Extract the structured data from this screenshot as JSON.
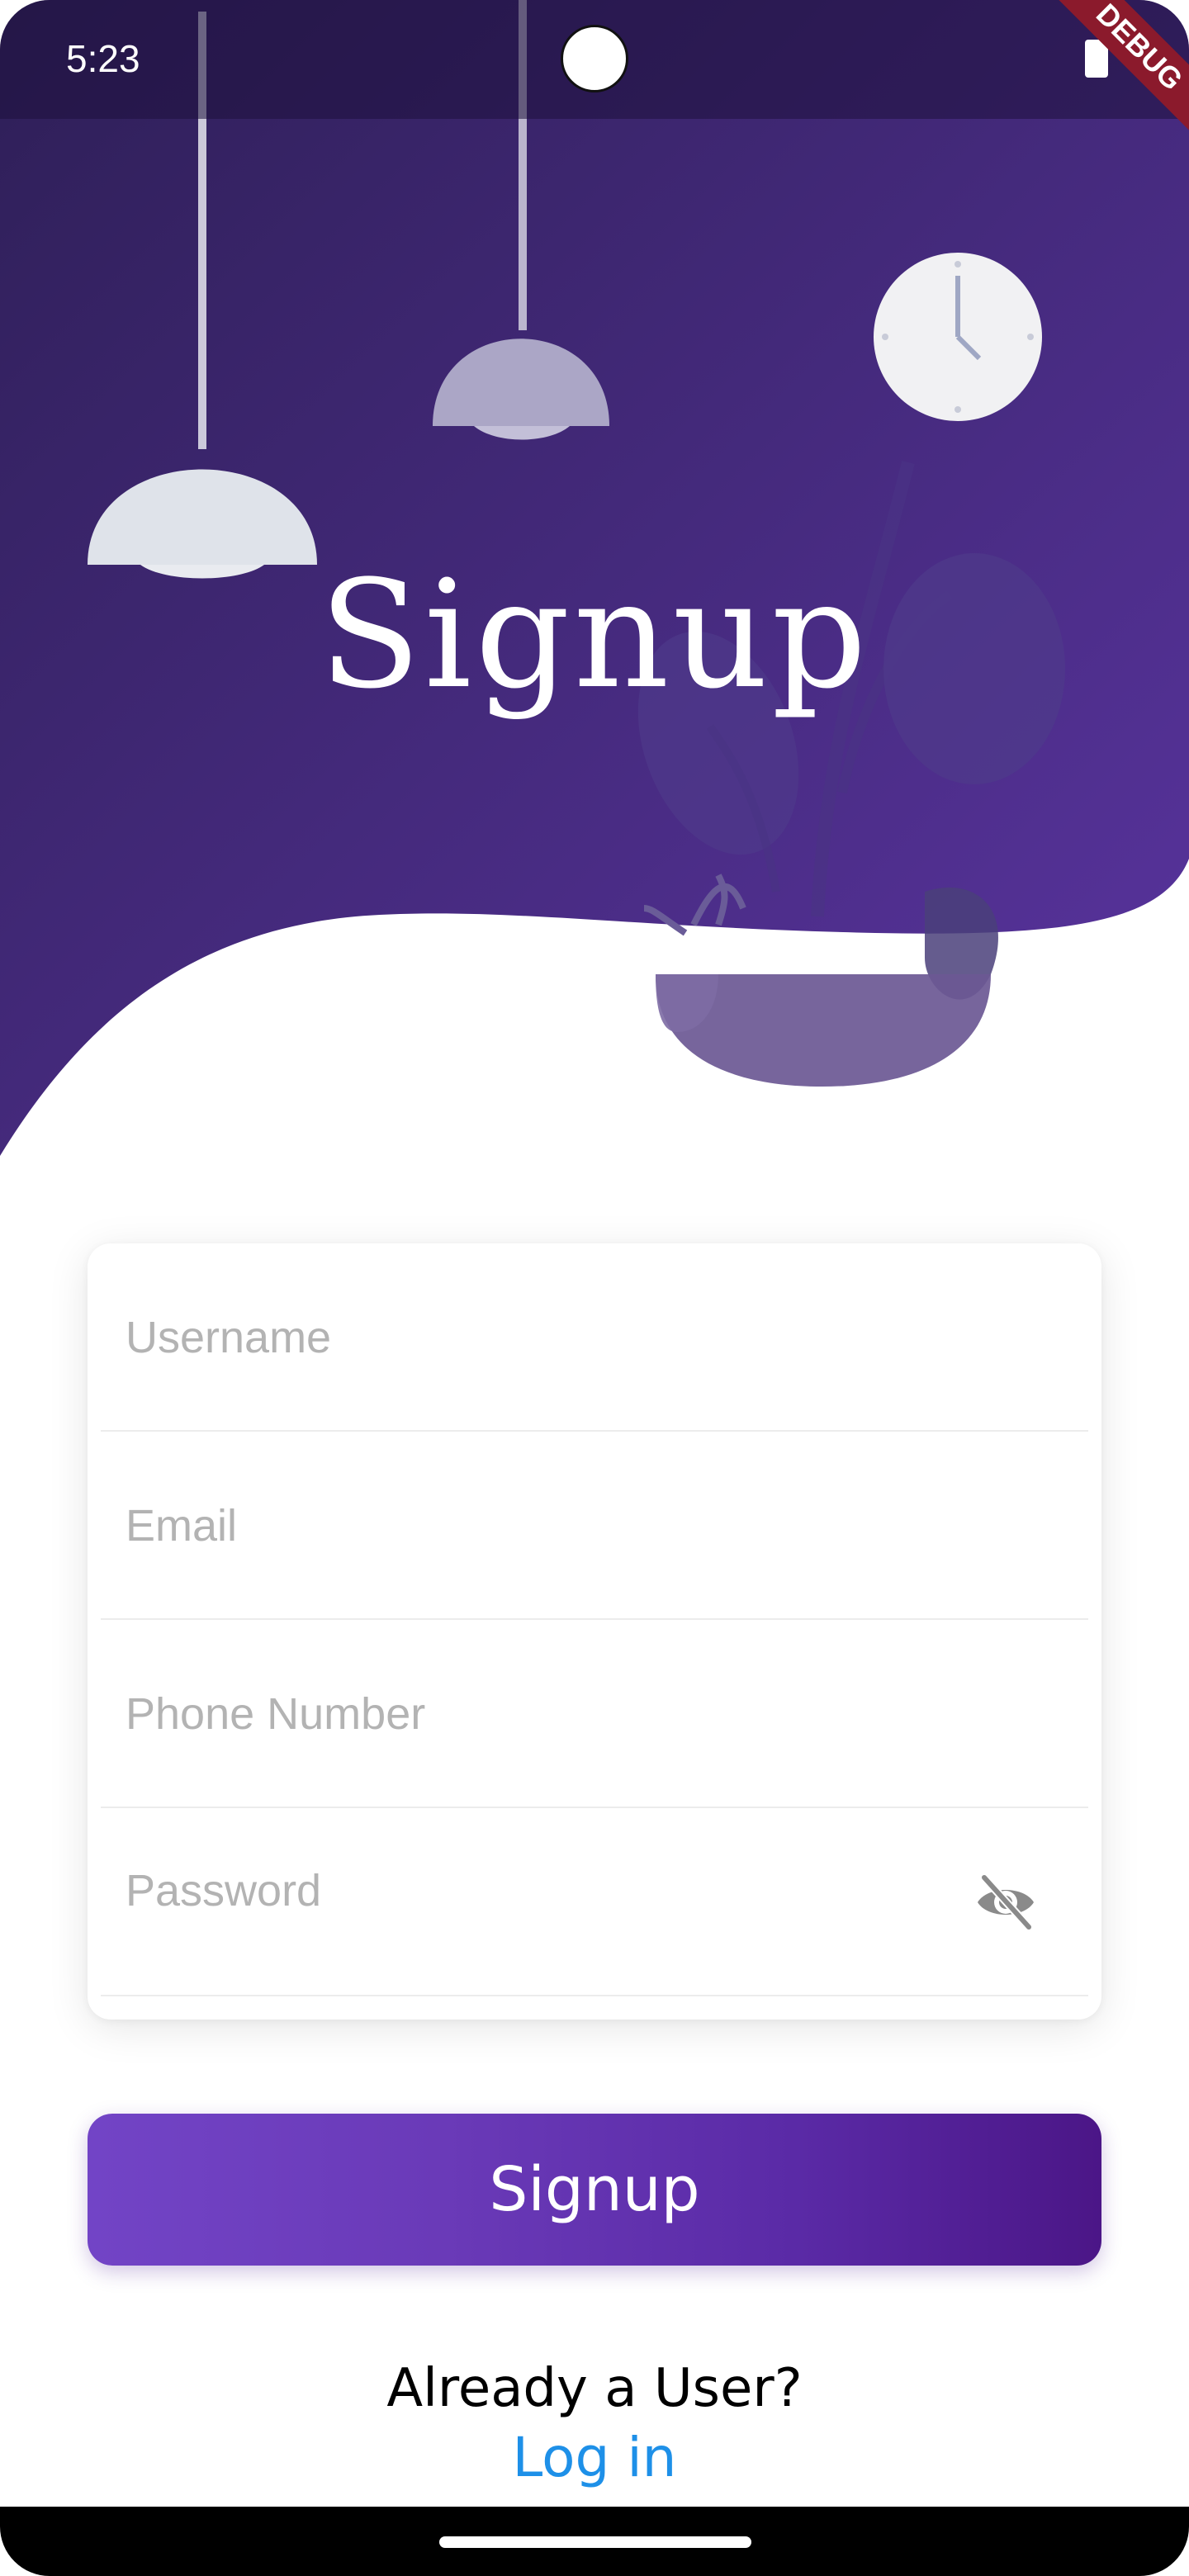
{
  "status_bar": {
    "time": "5:23",
    "debug_label": "DEBUG"
  },
  "colors": {
    "header_top": "#2e1f57",
    "header_bottom": "#5a34a0",
    "button_start": "#7244c6",
    "button_end": "#4b1687",
    "link": "#1e90e8"
  },
  "header": {
    "title": "Signup"
  },
  "form": {
    "username_placeholder": "Username",
    "email_placeholder": "Email",
    "phone_placeholder": "Phone Number",
    "password_placeholder": "Password",
    "password_toggle_icon": "eye-off-icon"
  },
  "actions": {
    "signup_label": "Signup"
  },
  "footer": {
    "prompt": "Already a User?",
    "login_label": "Log in"
  }
}
